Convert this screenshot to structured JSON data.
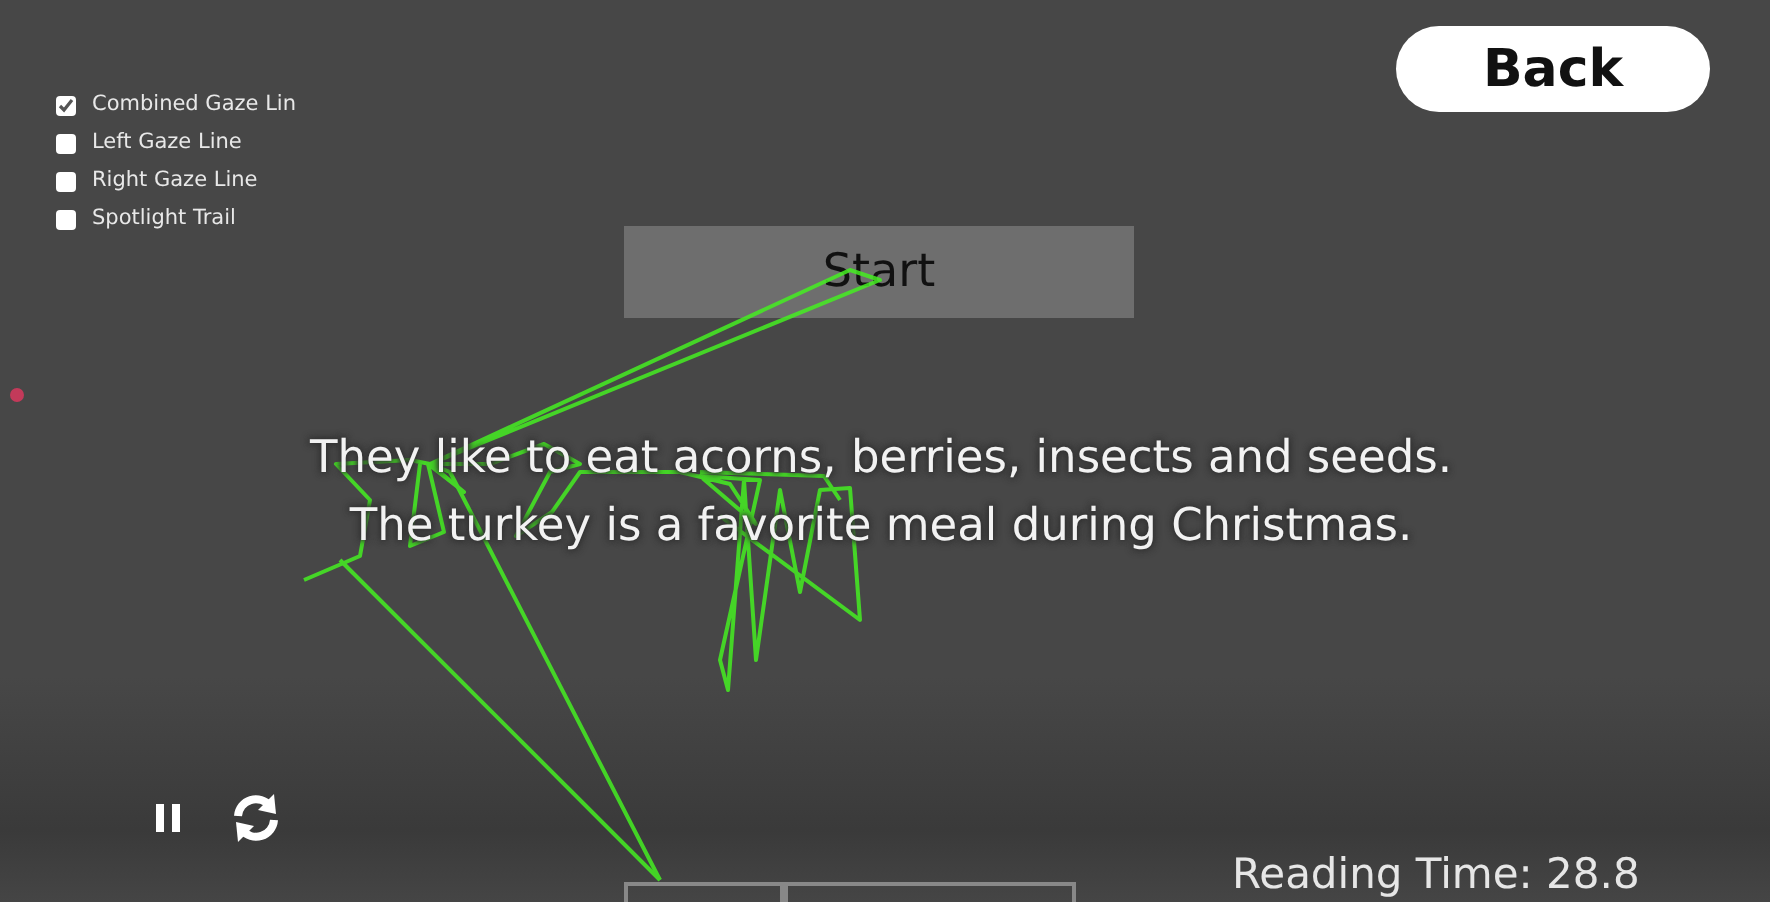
{
  "overlay_options": [
    {
      "label": "Combined Gaze Lin",
      "checked": true
    },
    {
      "label": "Left Gaze Line",
      "checked": false
    },
    {
      "label": "Right Gaze Line",
      "checked": false
    },
    {
      "label": "Spotlight Trail",
      "checked": false
    }
  ],
  "back_button": "Back",
  "start_button": "Start",
  "passage": [
    "They like to eat acorns, berries, insects and seeds.",
    "The turkey is a favorite meal during Christmas."
  ],
  "playback_controls": [
    {
      "kind": "pause"
    },
    {
      "kind": "replay"
    }
  ],
  "reading_time": "Reading Time:  28.8"
}
